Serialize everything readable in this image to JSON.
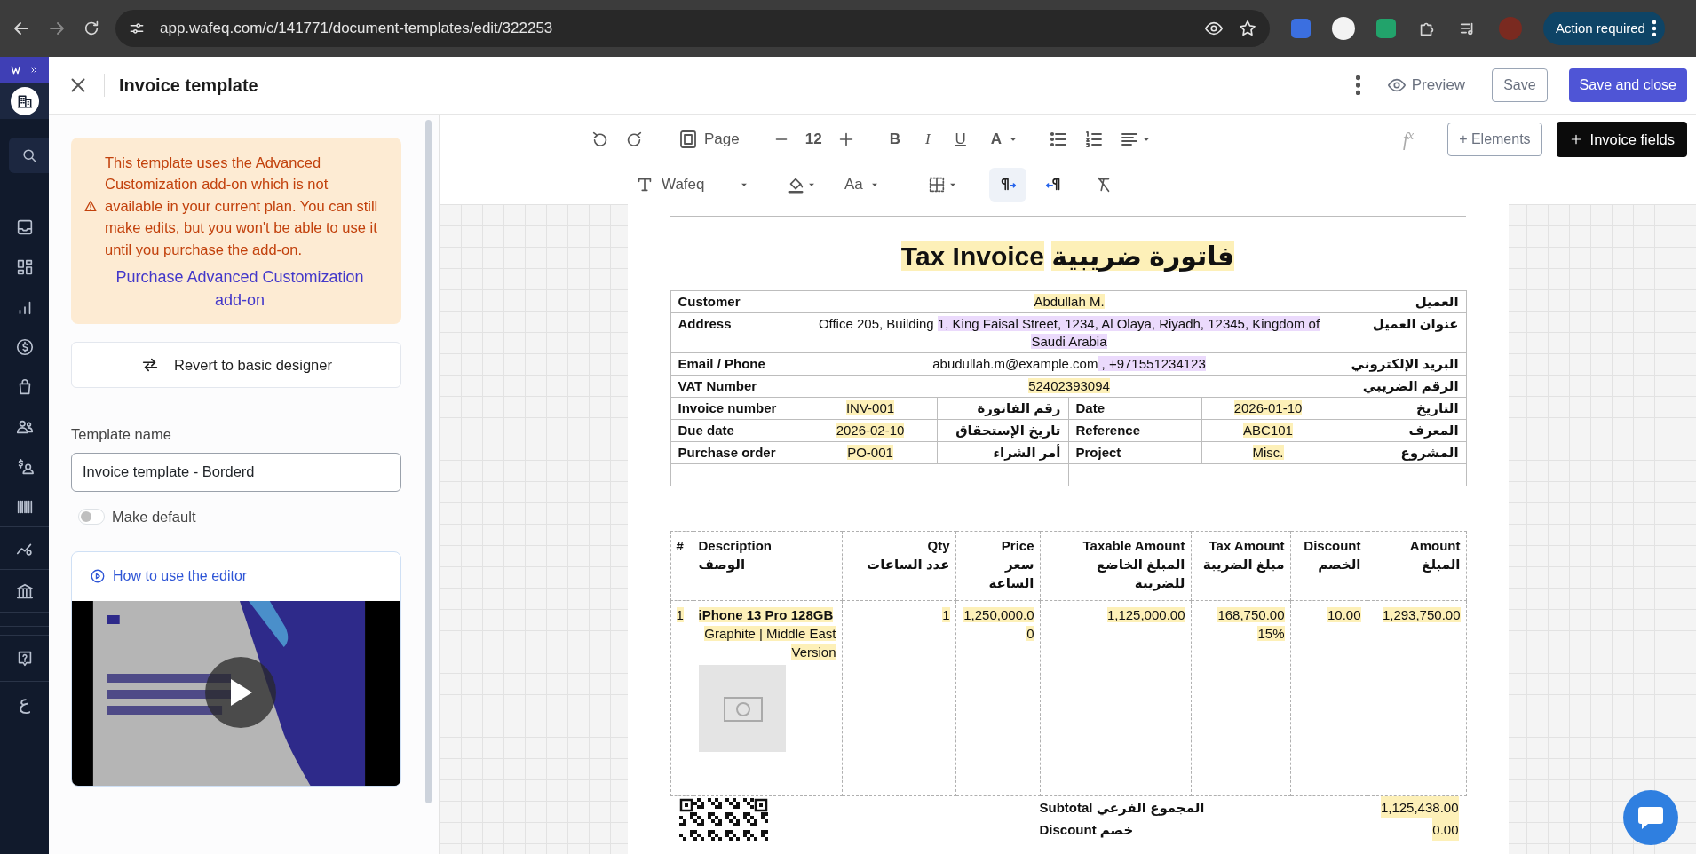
{
  "browser": {
    "url": "app.wafeq.com/c/141771/document-templates/edit/322253",
    "action_button": "Action required"
  },
  "rail": {
    "language": "ع"
  },
  "header": {
    "title": "Invoice template",
    "preview": "Preview",
    "save": "Save",
    "save_close": "Save and close"
  },
  "panel": {
    "notice": "This template uses the Advanced Customization add-on which is not available in your current plan. You can still make edits, but you won't be able to use it until you purchase the add-on.",
    "notice_link": "Purchase Advanced Customization add-on",
    "revert": "Revert to basic designer",
    "name_label": "Template name",
    "name_value": "Invoice template - Borderd",
    "make_default": {
      "label": "Make default",
      "on": false
    },
    "video": {
      "title": "How to use the editor"
    }
  },
  "toolbar": {
    "page": "Page",
    "font_size": "12",
    "bold": "B",
    "italic": "I",
    "underline": "U",
    "text_color": "A",
    "formula": "f$^{x}$",
    "elements": "+ Elements",
    "invoice_fields": "Invoice fields",
    "font": "Wafeq",
    "case": "Aa",
    "directions": [
      {
        "selected": true
      },
      {
        "selected": false
      }
    ]
  },
  "invoice": {
    "title_en": "Tax Invoice",
    "title_ar": "فاتورة ضريبية",
    "info_rows": [
      {
        "kind": "full",
        "label": "Customer",
        "value": [
          {
            "text": "Abdullah M.",
            "color": "#fdf0b8"
          }
        ],
        "label_ar": "العميل"
      },
      {
        "kind": "full",
        "label": "Address",
        "value": [
          {
            "text": "Office 205, Building "
          },
          {
            "text": "1, King Faisal Street, 1234, Al Olaya, Riyadh, 12345, Kingdom of Saudi Arabia",
            "color": "#ebdafc"
          }
        ],
        "label_ar": "عنوان العميل"
      },
      {
        "kind": "full",
        "label": "Email / Phone",
        "value": [
          {
            "text": "abudullah.m@example.com"
          },
          {
            "text": " , +971551234123",
            "color": "#ebdafc"
          }
        ],
        "label_ar": "البريد الإلكتروني"
      },
      {
        "kind": "full",
        "label": "VAT Number",
        "value": [
          {
            "text": "52402393094",
            "color": "#fdf0b8"
          }
        ],
        "label_ar": "الرقم الضريبي"
      },
      {
        "kind": "split",
        "left": {
          "label": "Invoice number",
          "value": [
            {
              "text": "INV-001",
              "color": "#fdf0b8"
            }
          ],
          "label_ar": "رقم الفاتورة"
        },
        "right": {
          "label": "Date",
          "value": [
            {
              "text": "2026-01-10",
              "color": "#fdf0b8"
            }
          ],
          "label_ar": "التاريخ"
        }
      },
      {
        "kind": "split",
        "left": {
          "label": "Due date",
          "value": [
            {
              "text": "2026-02-10",
              "color": "#fdf0b8"
            }
          ],
          "label_ar": "تاريخ الإستحقاق"
        },
        "right": {
          "label": "Reference",
          "value": [
            {
              "text": "ABC101",
              "color": "#fdf0b8"
            }
          ],
          "label_ar": "المعرف"
        }
      },
      {
        "kind": "split",
        "left": {
          "label": "Purchase order",
          "value": [
            {
              "text": "PO-001",
              "color": "#fdf0b8"
            }
          ],
          "label_ar": "أمر الشراء"
        },
        "right": {
          "label": "Project",
          "value": [
            {
              "text": "Misc.",
              "color": "#fdf0b8"
            }
          ],
          "label_ar": "المشروع"
        }
      },
      {
        "kind": "blank"
      }
    ],
    "columns": {
      "index": {
        "en": "#"
      },
      "description": {
        "en": "Description",
        "ar": "الوصف"
      },
      "qty": {
        "en": "Qty",
        "ar": "عدد الساعات"
      },
      "price": {
        "en": "Price",
        "ar": "سعر الساعة"
      },
      "taxable": {
        "en": "Taxable Amount",
        "ar": "المبلغ الخاضع للضريبة"
      },
      "tax": {
        "en": "Tax Amount",
        "ar": "مبلغ الضريبة"
      },
      "discount": {
        "en": "Discount",
        "ar": "الخصم"
      },
      "amount": {
        "en": "Amount",
        "ar": "المبلغ"
      }
    },
    "items": [
      {
        "index": "1",
        "name": "iPhone 13 Pro 128GB",
        "detail": "Graphite | Middle East Version",
        "qty": "1",
        "price": "1,250,000.00",
        "taxable": "1,125,000.00",
        "tax": "168,750.00",
        "tax_rate": "15%",
        "discount": "10.00",
        "amount": "1,293,750.00"
      }
    ],
    "totals": [
      {
        "label": "Subtotal المجموع الفرعي",
        "value": "1,125,438.00"
      },
      {
        "label": "Discount خصم",
        "value": "0.00"
      }
    ]
  }
}
